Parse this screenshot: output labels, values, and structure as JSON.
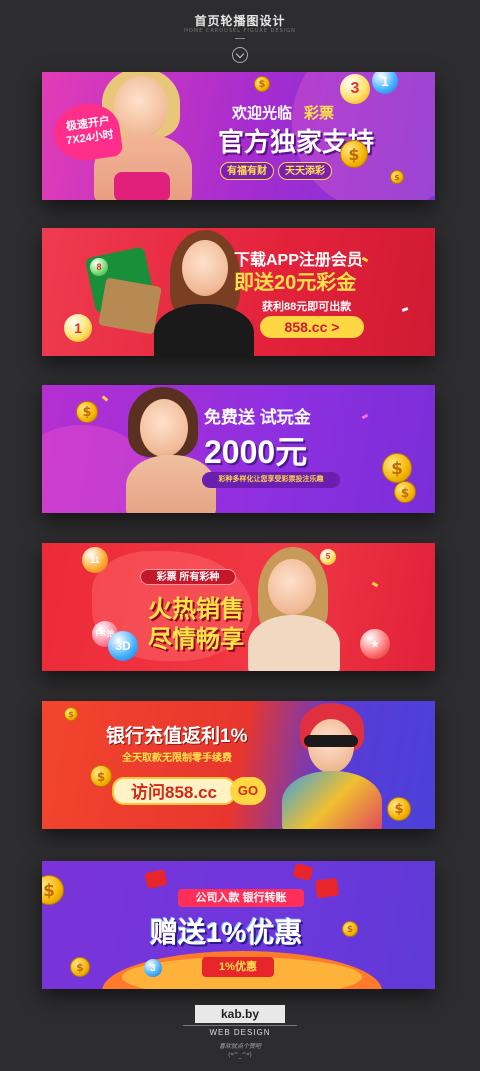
{
  "header": {
    "title": "首页轮播图设计",
    "subtitle": "HOME CAROUSEL FIGURE DESIGN"
  },
  "banners": [
    {
      "badge": "极速开户 7X24小时",
      "welcome": "欢迎光临",
      "brand": "彩票",
      "headline": "官方独家支持",
      "tag1": "有福有财",
      "tag2": "天天添彩"
    },
    {
      "line1": "下载APP注册会员",
      "line2": "即送20元彩金",
      "line3": "获利88元即可出款",
      "button": "858.cc >"
    },
    {
      "line1": "免费送 试玩金",
      "amount": "2000元",
      "note": "彩种多样化让您享受彩票投注乐趣"
    },
    {
      "tag": "彩票  所有彩种",
      "line1": "火热销售",
      "line2": "尽情畅享",
      "ball_pk": "PK拾",
      "ball_3d": "3D"
    },
    {
      "line1": "银行充值返利1%",
      "line2": "全天取款无限制零手续费",
      "visit": "访问858.cc",
      "go": "GO"
    },
    {
      "tag": "公司入款 银行转账",
      "headline": "赠送1%优惠",
      "badge": "1%优惠"
    }
  ],
  "footer": {
    "brand": "kab.by",
    "web": "WEB DESIGN",
    "note": "喜欢就点个赞吧",
    "face": "(*^_^*)"
  },
  "colors": {
    "background": "#2d2d2f",
    "gold": "#f5b300",
    "banner1": "#a42cd0",
    "banner2": "#e3223a",
    "banner3": "#8d2fe0",
    "banner4": "#f03844",
    "banner5": "#e8362e",
    "banner6": "#6d37dc"
  }
}
